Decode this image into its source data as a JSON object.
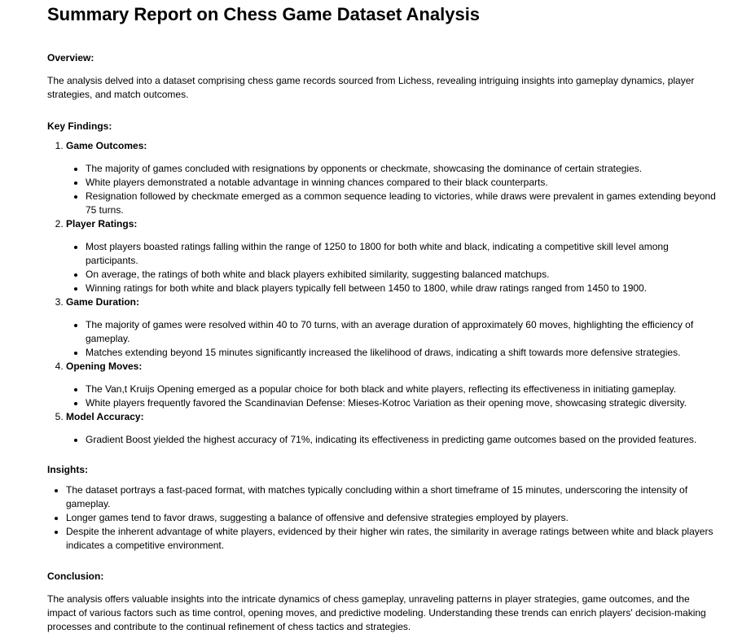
{
  "title": "Summary Report on Chess Game Dataset Analysis",
  "overview": {
    "heading": "Overview:",
    "text": "The analysis delved into a dataset comprising chess game records sourced from Lichess, revealing intriguing insights into gameplay dynamics, player strategies, and match outcomes."
  },
  "key_findings": {
    "heading": "Key Findings:",
    "items": [
      {
        "title": "Game Outcomes:",
        "bullets": [
          "The majority of games concluded with resignations by opponents or checkmate, showcasing the dominance of certain strategies.",
          "White players demonstrated a notable advantage in winning chances compared to their black counterparts.",
          "Resignation followed by checkmate emerged as a common sequence leading to victories, while draws were prevalent in games extending beyond 75 turns."
        ]
      },
      {
        "title": "Player Ratings:",
        "bullets": [
          "Most players boasted ratings falling within the range of 1250 to 1800 for both white and black, indicating a competitive skill level among participants.",
          "On average, the ratings of both white and black players exhibited similarity, suggesting balanced matchups.",
          "Winning ratings for both white and black players typically fell between 1450 to 1800, while draw ratings ranged from 1450 to 1900."
        ]
      },
      {
        "title": "Game Duration:",
        "bullets": [
          "The majority of games were resolved within 40 to 70 turns, with an average duration of approximately 60 moves, highlighting the efficiency of gameplay.",
          "Matches extending beyond 15 minutes significantly increased the likelihood of draws, indicating a shift towards more defensive strategies."
        ]
      },
      {
        "title": "Opening Moves:",
        "bullets": [
          "The Van,t Kruijs Opening emerged as a popular choice for both black and white players, reflecting its effectiveness in initiating gameplay.",
          "White players frequently favored the Scandinavian Defense: Mieses-Kotroc Variation as their opening move, showcasing strategic diversity."
        ]
      },
      {
        "title": "Model Accuracy:",
        "bullets": [
          "Gradient Boost yielded the highest accuracy of 71%, indicating its effectiveness in predicting game outcomes based on the provided features."
        ]
      }
    ]
  },
  "insights": {
    "heading": "Insights:",
    "bullets": [
      "The dataset portrays a fast-paced format, with matches typically concluding within a short timeframe of 15 minutes, underscoring the intensity of gameplay.",
      "Longer games tend to favor draws, suggesting a balance of offensive and defensive strategies employed by players.",
      "Despite the inherent advantage of white players, evidenced by their higher win rates, the similarity in average ratings between white and black players indicates a competitive environment."
    ]
  },
  "conclusion": {
    "heading": "Conclusion:",
    "text": "The analysis offers valuable insights into the intricate dynamics of chess gameplay, unraveling patterns in player strategies, game outcomes, and the impact of various factors such as time control, opening moves, and predictive modeling. Understanding these trends can enrich players' decision-making processes and contribute to the continual refinement of chess tactics and strategies."
  }
}
